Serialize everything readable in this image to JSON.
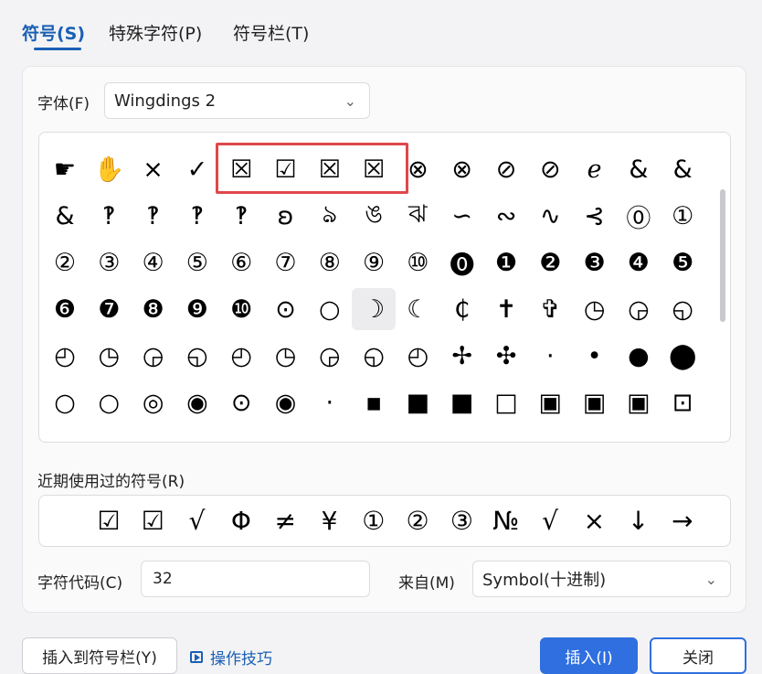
{
  "tabs": [
    {
      "label": "符号(S)",
      "active": true
    },
    {
      "label": "特殊字符(P)",
      "active": false
    },
    {
      "label": "符号栏(T)",
      "active": false
    }
  ],
  "font": {
    "label": "字体(F)",
    "value": "Wingdings 2"
  },
  "symbol_grid": {
    "rows": [
      [
        "☛",
        "✋",
        "×",
        "✓",
        "☒",
        "☑",
        "☒",
        "☒",
        "⊗",
        "⊗",
        "⊘",
        "⊘",
        "ℯ",
        "&",
        "&"
      ],
      [
        "&",
        "‽",
        "‽",
        "‽",
        "‽",
        "ʚ",
        "ঌ",
        "ঙ",
        "ঝ",
        "∽",
        "∾",
        "∿",
        "⊰",
        "⓪",
        "①"
      ],
      [
        "②",
        "③",
        "④",
        "⑤",
        "⑥",
        "⑦",
        "⑧",
        "⑨",
        "⑩",
        "⓿",
        "❶",
        "❷",
        "❸",
        "❹",
        "❺"
      ],
      [
        "❻",
        "❼",
        "❽",
        "❾",
        "❿",
        "⊙",
        "○",
        "☽",
        "☾",
        "₵",
        "✝",
        "✞",
        "◷",
        "◶",
        "◵"
      ],
      [
        "◴",
        "◷",
        "◶",
        "◵",
        "◴",
        "◷",
        "◶",
        "◵",
        "◴",
        "✢",
        "✣",
        "·",
        "•",
        "●",
        "⬤"
      ],
      [
        "○",
        "○",
        "◎",
        "◉",
        "⊙",
        "◉",
        "·",
        "▪",
        "■",
        "■",
        "□",
        "▣",
        "▣",
        "▣",
        "⊡"
      ]
    ],
    "selected": "☽",
    "selected_row": 3,
    "selected_col": 7
  },
  "recent": {
    "label": "近期使用过的符号(R)",
    "symbols": [
      "☑",
      "☑",
      "√",
      "Φ",
      "≠",
      "¥",
      "①",
      "②",
      "③",
      "№",
      "√",
      "×",
      "↓",
      "→"
    ]
  },
  "char_code": {
    "label": "字符代码(C)",
    "value": "32"
  },
  "from": {
    "label": "来自(M)",
    "value": "Symbol(十进制)"
  },
  "buttons": {
    "insert_to_bar": "插入到符号栏(Y)",
    "tips": "操作技巧",
    "insert": "插入(I)",
    "close": "关闭"
  },
  "colors": {
    "accent": "#2f6fe0",
    "tab_active": "#1a5fb4",
    "highlight": "#e0474b"
  },
  "icons": {
    "dropdown": "chevron-down-icon",
    "tips": "play-icon"
  }
}
